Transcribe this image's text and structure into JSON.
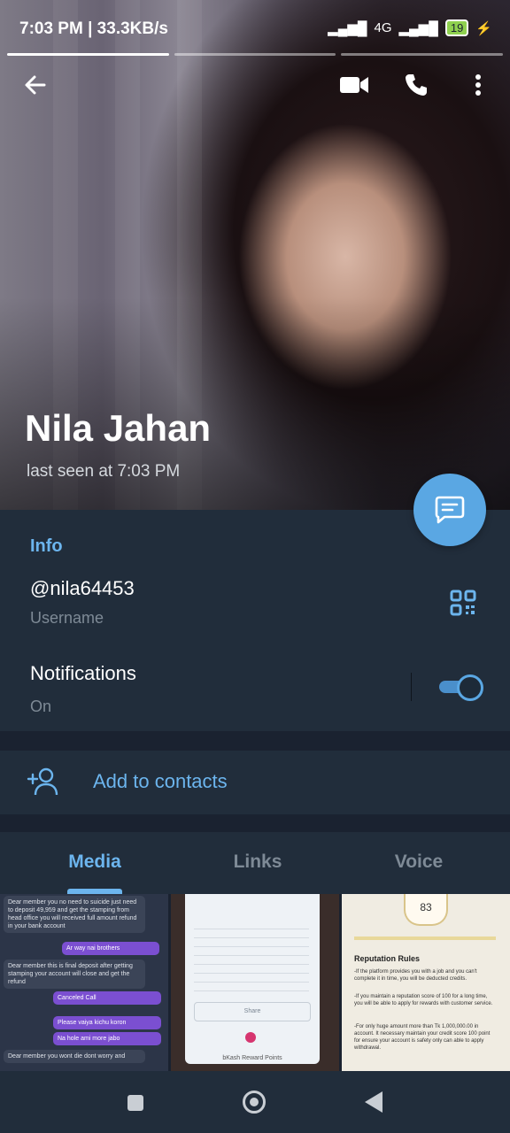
{
  "status": {
    "time_speed": "7:03 PM | 33.3KB/s",
    "network": "4G",
    "battery": "19"
  },
  "profile": {
    "name": "Nila Jahan",
    "last_seen": "last seen at 7:03 PM"
  },
  "info": {
    "title": "Info",
    "username": "@nila64453",
    "username_label": "Username",
    "notifications_label": "Notifications",
    "notifications_state": "On",
    "notifications_on": true
  },
  "actions": {
    "add_contact": "Add to contacts"
  },
  "tabs": [
    {
      "label": "Media",
      "active": true
    },
    {
      "label": "Links",
      "active": false
    },
    {
      "label": "Voice",
      "active": false
    }
  ],
  "media": {
    "thumb1": {
      "msg1": "Dear member you no need to suicide just need to deposit 49,959 and get the stamping from head office you will received full amount refund in your bank account",
      "msg2": "Ar way nai brothers",
      "msg3": "Dear member this is final deposit after getting stamping your account will close and get the refund",
      "msg4": "Canceled Call",
      "msg5": "Please vaiya kichu koron",
      "msg6": "Na hole ami more jabo",
      "msg7": "Dear member you wont die dont worry and"
    },
    "thumb2": {
      "share": "Share",
      "reward": "bKash Reward Points"
    },
    "thumb3": {
      "score": "83",
      "heading": "Reputation Rules",
      "rule1": "-If the platform provides you with a job and you can't complete it in time, you will be deducted credits.",
      "rule2": "-If you maintain a reputation score of 100 for a long time, you will be able to apply for rewards with customer service.",
      "rule3": "-For only huge amount more than Tk 1,000,000.00 in account. It necessary maintain your credit score 100 point for ensure your account is safety only can able to apply withdrawal."
    }
  },
  "colors": {
    "accent": "#6cb5ee",
    "card_bg": "#212d3b",
    "page_bg": "#1a2230",
    "fab": "#5aa7e3"
  }
}
